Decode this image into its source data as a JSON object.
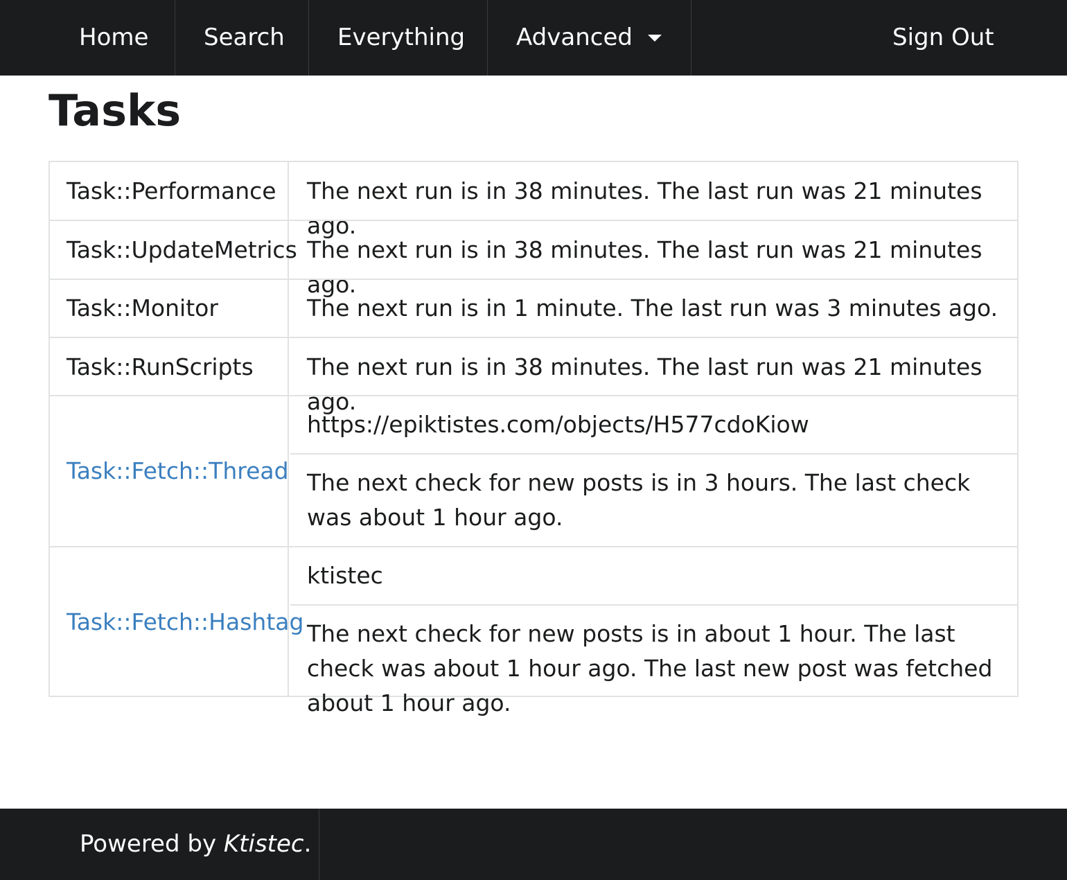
{
  "nav": {
    "home": "Home",
    "search": "Search",
    "everything": "Everything",
    "advanced": "Advanced",
    "sign_out": "Sign Out"
  },
  "page": {
    "title": "Tasks"
  },
  "tasks": [
    {
      "name": "Task::Performance",
      "description": "The next run is in 38 minutes. The last run was 21 minutes ago."
    },
    {
      "name": "Task::UpdateMetrics",
      "description": "The next run is in 38 minutes. The last run was 21 minutes ago."
    },
    {
      "name": "Task::Monitor",
      "description": "The next run is in 1 minute. The last run was 3 minutes ago."
    },
    {
      "name": "Task::RunScripts",
      "description": "The next run is in 38 minutes. The last run was 21 minutes ago."
    },
    {
      "name": "Task::Fetch::Thread",
      "subject": "https://epiktistes.com/objects/H577cdoKiow",
      "description": "The next check for new posts is in 3 hours. The last check was about 1 hour ago."
    },
    {
      "name": "Task::Fetch::Hashtag",
      "subject": "ktistec",
      "description": "The next check for new posts is in about 1 hour. The last check was about 1 hour ago. The last new post was fetched about 1 hour ago."
    }
  ],
  "footer": {
    "powered_by": "Powered by",
    "brand": "Ktistec",
    "period": "."
  },
  "colors": {
    "bar": "#1b1c1d",
    "link": "#3b7fbf",
    "border": "#e1e2e3"
  }
}
